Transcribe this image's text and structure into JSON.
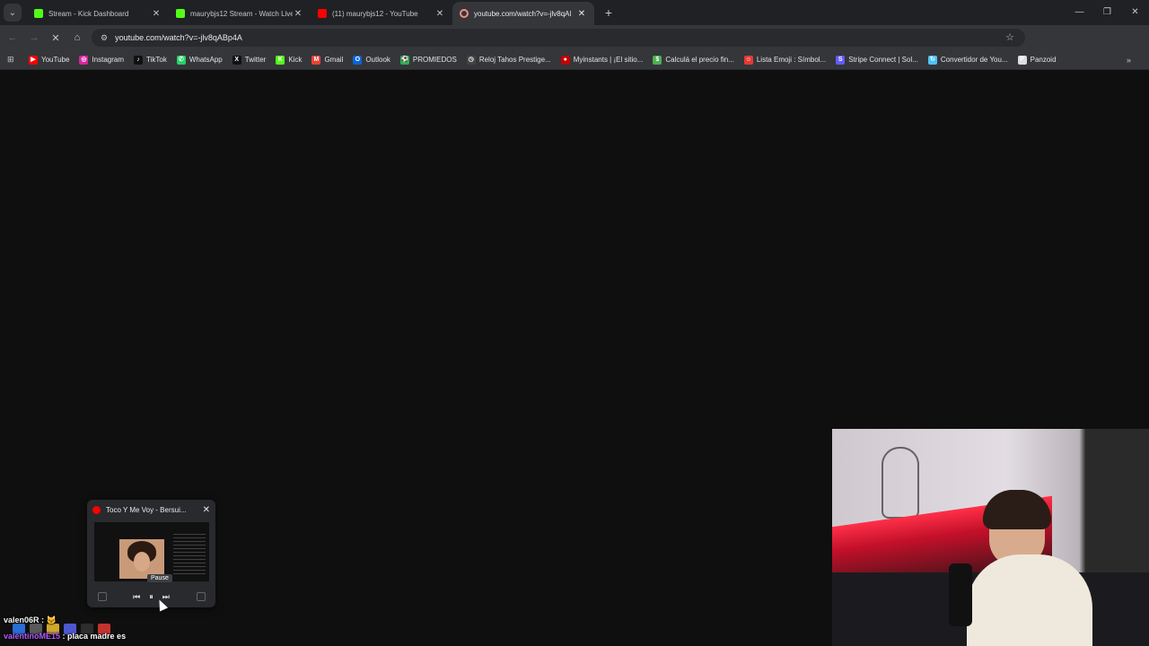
{
  "browser": {
    "tabs": [
      {
        "title": "Stream - Kick Dashboard",
        "icon": "kick-icon",
        "color": "#53fc18",
        "active": false
      },
      {
        "title": "maurybjs12 Stream - Watch Live",
        "icon": "kick-icon",
        "color": "#53fc18",
        "active": false
      },
      {
        "title": "(11) maurybjs12 - YouTube",
        "icon": "youtube-icon",
        "color": "#ff0000",
        "active": false
      },
      {
        "title": "youtube.com/watch?v=-jlv8qAl",
        "icon": "loading-icon",
        "color": "#f28b82",
        "active": true
      }
    ],
    "url": "youtube.com/watch?v=-jlv8qABp4A",
    "bookmarks": [
      {
        "label": "YouTube",
        "color": "#ff0000",
        "glyph": "▶"
      },
      {
        "label": "Instagram",
        "color": "#d6249f",
        "glyph": "◎"
      },
      {
        "label": "TikTok",
        "color": "#111111",
        "glyph": "♪"
      },
      {
        "label": "WhatsApp",
        "color": "#25d366",
        "glyph": "✆"
      },
      {
        "label": "Twitter",
        "color": "#111111",
        "glyph": "X"
      },
      {
        "label": "Kick",
        "color": "#53fc18",
        "glyph": "K"
      },
      {
        "label": "Gmail",
        "color": "#ea4335",
        "glyph": "M"
      },
      {
        "label": "Outlook",
        "color": "#0a64d8",
        "glyph": "O"
      },
      {
        "label": "PROMIEDOS",
        "color": "#2bb34a",
        "glyph": "⚽"
      },
      {
        "label": "Reloj Tahos Prestige...",
        "color": "#444444",
        "glyph": "◷"
      },
      {
        "label": "Myinstants | ¡El sitio...",
        "color": "#c40000",
        "glyph": "●"
      },
      {
        "label": "Calculá el precio fin...",
        "color": "#4caf50",
        "glyph": "$"
      },
      {
        "label": "Lista Emoji : Símbol...",
        "color": "#e53935",
        "glyph": "☺"
      },
      {
        "label": "Stripe Connect | Sol...",
        "color": "#635bff",
        "glyph": "S"
      },
      {
        "label": "Convertidor de You...",
        "color": "#4fc3f7",
        "glyph": "↻"
      },
      {
        "label": "Panzoid",
        "color": "#dddddd",
        "glyph": "P"
      }
    ]
  },
  "mini_player": {
    "title": "Toco Y Me Voy - Bersui...",
    "tooltip": "Pause"
  },
  "chat": [
    {
      "user": "valen06R",
      "sep": " : ",
      "text": "🐱"
    },
    {
      "user": "valentinoME15",
      "sep": " : ",
      "text": "placa madre es"
    }
  ]
}
